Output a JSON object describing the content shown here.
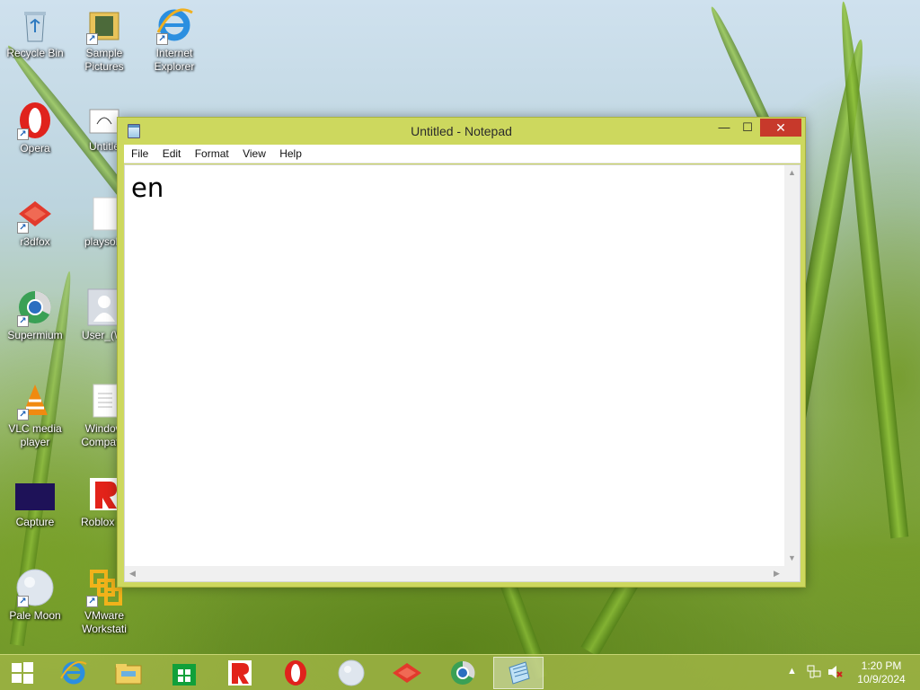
{
  "desktop": {
    "icons": [
      {
        "label": "Recycle Bin",
        "icon": "recycle-bin-icon"
      },
      {
        "label": "Sample Pictures",
        "icon": "folder-icon"
      },
      {
        "label": "Internet Explorer",
        "icon": "internet-explorer-icon"
      },
      {
        "label": "Opera",
        "icon": "opera-icon"
      },
      {
        "label": "Untitle",
        "icon": "document-icon"
      },
      {
        "label": "r3dfox",
        "icon": "r3dfox-icon"
      },
      {
        "label": "playsolo",
        "icon": "file-icon"
      },
      {
        "label": "Supermium",
        "icon": "supermium-icon"
      },
      {
        "label": "User_(Wi",
        "icon": "user-icon"
      },
      {
        "label": "VLC media player",
        "icon": "vlc-icon"
      },
      {
        "label": "Window Compatib",
        "icon": "text-file-icon"
      },
      {
        "label": "Capture",
        "icon": "capture-icon"
      },
      {
        "label": "Roblox St",
        "icon": "roblox-icon"
      },
      {
        "label": "Pale Moon",
        "icon": "pale-moon-icon"
      },
      {
        "label": "VMware Workstati",
        "icon": "vmware-icon"
      }
    ]
  },
  "window": {
    "title": "Untitled - Notepad",
    "minimize_glyph": "—",
    "maximize_glyph": "☐",
    "close_glyph": "✕",
    "menu": [
      "File",
      "Edit",
      "Format",
      "View",
      "Help"
    ],
    "content": "en"
  },
  "taskbar": {
    "items": [
      "start",
      "internet-explorer",
      "file-explorer",
      "store",
      "roblox",
      "opera",
      "pale-moon",
      "r3dfox",
      "supermium",
      "notepad"
    ],
    "active": "notepad",
    "time": "1:20 PM",
    "date": "10/9/2024"
  },
  "colors": {
    "window_frame": "#cdd85e",
    "close_button": "#c7392b",
    "taskbar": "#a0b446"
  }
}
